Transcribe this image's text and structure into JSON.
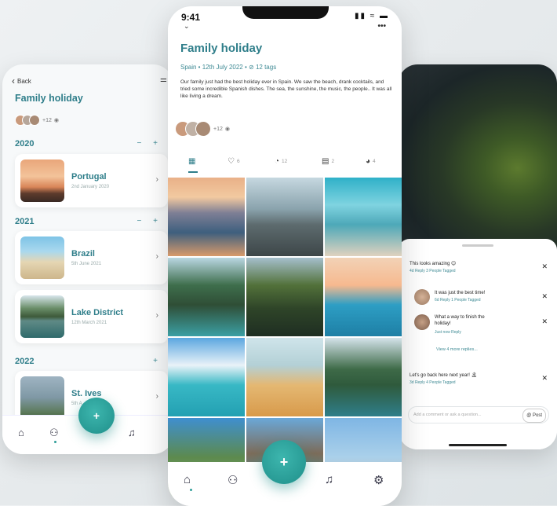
{
  "left": {
    "back": "Back",
    "title": "Family holiday",
    "avatars_more": "+12",
    "years": [
      {
        "label": "2020",
        "controls": "− +"
      },
      {
        "label": "2021",
        "controls": "− +"
      },
      {
        "label": "2022",
        "controls": "+"
      }
    ],
    "trips": [
      {
        "name": "Portugal",
        "date": "2nd January 2020"
      },
      {
        "name": "Brazil",
        "date": "5th June 2021"
      },
      {
        "name": "Lake District",
        "date": "12th March 2021"
      },
      {
        "name": "St. Ives",
        "date": "5th A"
      }
    ],
    "fab": "+"
  },
  "center": {
    "time": "9:41",
    "title": "Family holiday",
    "meta": "Spain  •  12th July 2022  •",
    "tags": "12 tags",
    "description": "Our family just had the best holiday ever in Spain. We saw the beach, drank cocktails, and tried some incredible Spanish dishes. The sea, the sunshine, the music, the people.. It was all like living a dream.",
    "avatars_more": "+12",
    "tabs": {
      "likes": "6",
      "comments": "12",
      "files": "2",
      "people": "4"
    },
    "fab": "+"
  },
  "right": {
    "comments": [
      {
        "text": "This looks amazing 😊",
        "sub": "4d   Reply   3 People Tagged"
      },
      {
        "text": "It was just the best time!",
        "sub": "6d   Reply   1 People Tagged"
      },
      {
        "text": "What a way to finish the holiday!",
        "sub": "Just now   Reply"
      },
      {
        "text": "Let's go back here next year! 🏝",
        "sub": "3d   Reply   4 People Tagged"
      }
    ],
    "more": "View 4 more replies...",
    "input_placeholder": "Add a comment or ask a question...",
    "post": "Post"
  },
  "colors": {
    "accent": "#2f7e8a",
    "fab": "#2aa39d"
  }
}
